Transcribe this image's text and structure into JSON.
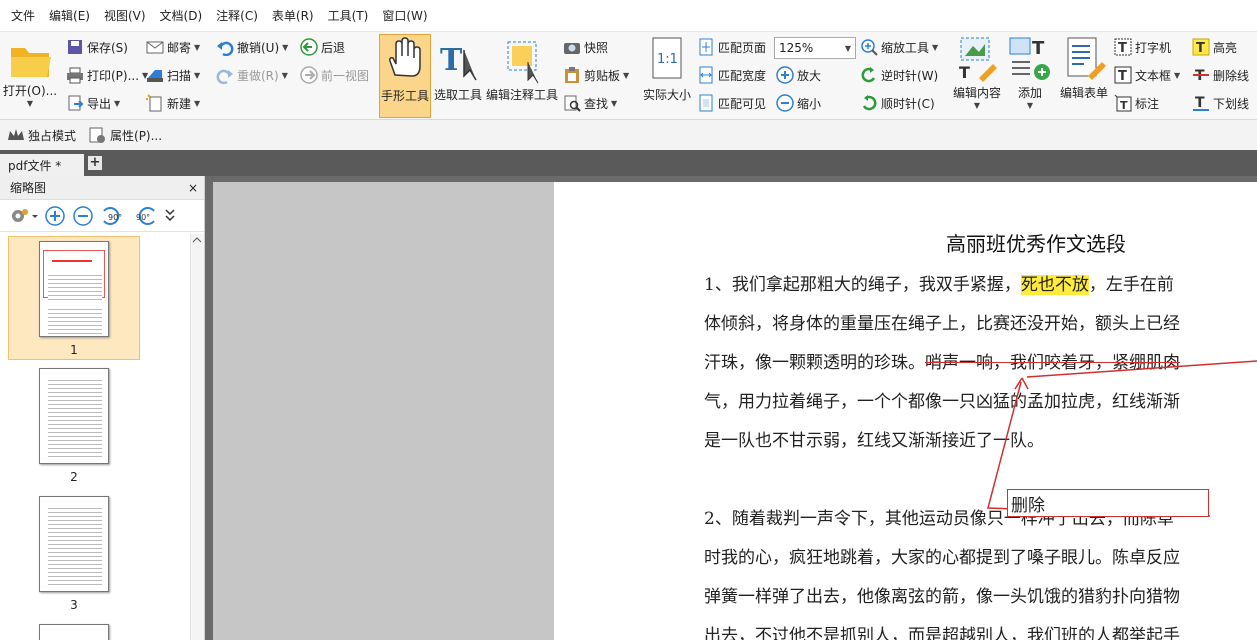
{
  "menu": [
    "文件",
    "编辑(E)",
    "视图(V)",
    "文档(D)",
    "注释(C)",
    "表单(R)",
    "工具(T)",
    "窗口(W)"
  ],
  "ribbon": {
    "open": "打开(O)...",
    "save": "保存(S)",
    "print": "打印(P)...",
    "export": "导出",
    "mail": "邮寄",
    "scan": "扫描",
    "new": "新建",
    "undo": "撤销(U)",
    "redo": "重做(R)",
    "back": "后退",
    "forward": "前一视图",
    "hand_tool": "手形工具",
    "select_tool": "选取工具",
    "edit_annot_tool": "编辑注释工具",
    "snapshot": "快照",
    "clipboard": "剪贴板",
    "find": "查找",
    "actual_size": "实际大小",
    "actual_size_icon_text": "1:1",
    "fit_page": "匹配页面",
    "fit_width": "匹配宽度",
    "fit_visible": "匹配可见",
    "zoom_value": "125%",
    "zoom_in": "放大",
    "zoom_out": "缩小",
    "zoom_tool": "缩放工具",
    "rotate_ccw": "逆时针(W)",
    "rotate_cw": "顺时针(C)",
    "edit_content": "编辑内容",
    "add": "添加",
    "edit_form": "编辑表单",
    "typewriter": "打字机",
    "textbox": "文本框",
    "callout": "标注",
    "highlight": "高亮",
    "strikeout": "删除线",
    "underline": "下划线"
  },
  "subbar": {
    "exclusive_mode": "独占模式",
    "properties": "属性(P)..."
  },
  "tab": {
    "name": "pdf文件 *",
    "new": "+"
  },
  "sidebar": {
    "title": "缩略图",
    "close": "×",
    "rotate_left": "90°",
    "rotate_right": "90°",
    "pages": [
      "1",
      "2",
      "3"
    ]
  },
  "document": {
    "title": "高丽班优秀作文选段",
    "p1_l1_a": "1、我们拿起那粗大的绳子，我双手紧握，",
    "p1_l1_hl": "死也不放",
    "p1_l1_b": "，左手在前",
    "p1_l2": "体倾斜，将身体的重量压在绳子上，比赛还没开始，额头上已经",
    "p1_l3_a": "汗珠，像一颗颗透明的珍珠。",
    "p1_l3_strike": "哨声一响，我们咬着牙，紧绷肌肉",
    "p1_l4": "气，用力拉着绳子，一个个都像一只凶猛的孟加拉虎，红线渐渐",
    "p1_l5": "是一队也不甘示弱，红线又渐渐接近了一队。",
    "p2_l1": "2、随着裁判一声令下，其他运动员像只一样冲了出去，而陈卓",
    "p2_l2": "时我的心，疯狂地跳着，大家的心都提到了嗓子眼儿。陈卓反应",
    "p2_l3": "弹簧一样弹了出去，他像离弦的箭，像一头饥饿的猎豹扑向猎物",
    "p2_l4": "出去，不过他不是抓别人，而是超越别人，我们班的人都举起手",
    "popup": "删除"
  },
  "colors": {
    "highlight": "#ffeb3b",
    "markup": "#d32f2f",
    "accent": "#fbd68a"
  }
}
